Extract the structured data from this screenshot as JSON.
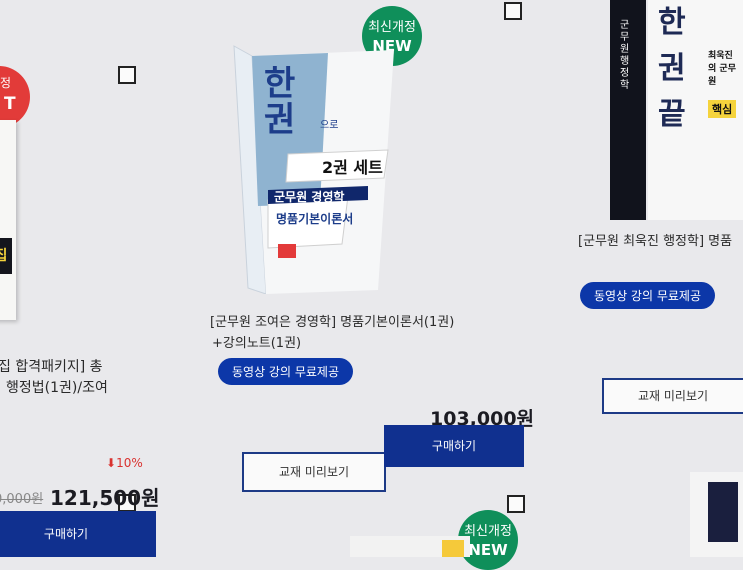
{
  "left_product": {
    "badge_partial": "T",
    "badge_top_partial": "정",
    "cover_partial": "집",
    "title_line1": "집 합격패키지] 총",
    "title_line2": "행정법(1권)/조여",
    "discount": "10%",
    "old_price": "0,000원",
    "price": "121,500원",
    "buy_label": "구매하기"
  },
  "center_product": {
    "badge_line1": "최신개정",
    "badge_line2": "NEW",
    "book_title_big": "한권",
    "book_title_suffix": "으로",
    "book_set_label": "2권 세트",
    "book_subject": "군무원 경영학",
    "book_series": "명품기본이론서",
    "title_line1": "[군무원 조여은 경영학] 명품기본이론서(1권)",
    "title_line2": "+강의노트(1권)",
    "pill": "동영상 강의 무료제공",
    "price": "103,000원",
    "preview_label": "교재 미리보기",
    "buy_label": "구매하기"
  },
  "right_product": {
    "book_title_big": "한권끝",
    "book_side_text": "군무원 행정학",
    "book_author": "최욱진의 군무원",
    "book_tag": "핵심",
    "title_line1": "[군무원 최욱진 행정학] 명품",
    "pill": "동영상 강의 무료제공",
    "preview_label": "교재 미리보기"
  },
  "bottom_center_badge": {
    "line1": "최신개정",
    "line2": "NEW"
  },
  "colors": {
    "background": "#e9e9ec",
    "navy": "#10308f",
    "pill_blue": "#0c37a8",
    "badge_green": "#0f8f5a",
    "badge_red": "#e23b39",
    "discount_red": "#d9322f"
  }
}
